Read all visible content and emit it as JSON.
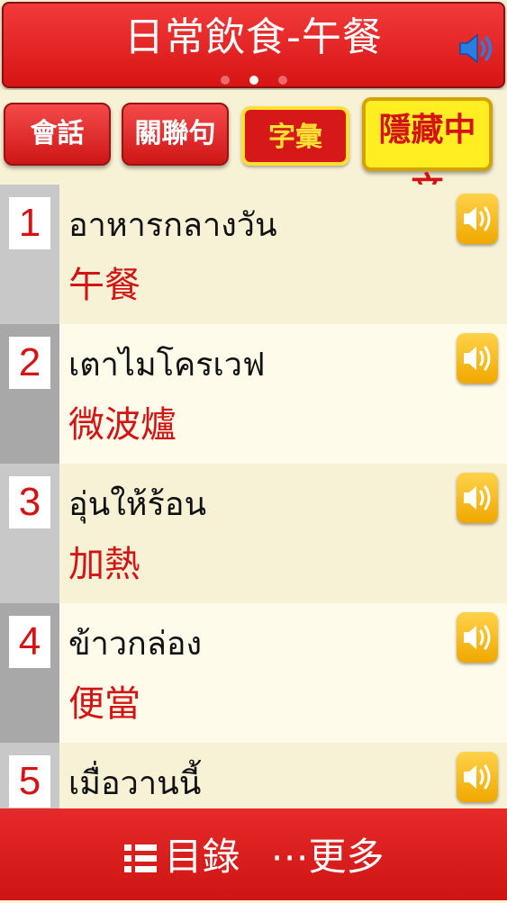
{
  "header": {
    "title": "日常飲食-午餐",
    "page_dots": 3,
    "active_dot": 1
  },
  "tabs": [
    {
      "label": "會話",
      "state": "default"
    },
    {
      "label": "關聯句",
      "state": "default"
    },
    {
      "label": "字彙",
      "state": "active"
    },
    {
      "label": "隱藏中文",
      "state": "highlight"
    }
  ],
  "vocab": [
    {
      "index": "1",
      "thai": "อาหารกลางวัน",
      "chinese": "午餐"
    },
    {
      "index": "2",
      "thai": "เตาไมโครเวฟ",
      "chinese": "微波爐"
    },
    {
      "index": "3",
      "thai": "อุ่นให้ร้อน",
      "chinese": "加熱"
    },
    {
      "index": "4",
      "thai": "ข้าวกล่อง",
      "chinese": "便當"
    },
    {
      "index": "5",
      "thai": "เมื่อวานนี้",
      "chinese": ""
    }
  ],
  "bottom_bar": {
    "menu_label": "目錄",
    "more_label": "⋯更多"
  },
  "colors": {
    "accent_red": "#d71818",
    "highlight_yellow": "#ffee22",
    "row_light": "#f7f1d6",
    "row_white": "#fffbea"
  }
}
